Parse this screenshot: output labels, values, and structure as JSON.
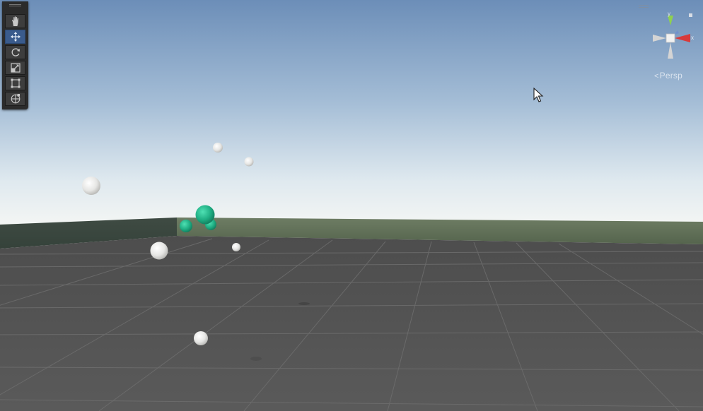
{
  "window": {
    "view": "Scene View"
  },
  "toolbar": {
    "tools": [
      {
        "id": "hand",
        "icon": "hand-icon",
        "active": false
      },
      {
        "id": "move",
        "icon": "move-icon",
        "active": true
      },
      {
        "id": "rotate",
        "icon": "rotate-icon",
        "active": false
      },
      {
        "id": "scale",
        "icon": "scale-icon",
        "active": false
      },
      {
        "id": "rect",
        "icon": "rect-transform-icon",
        "active": false
      },
      {
        "id": "transform",
        "icon": "transform-icon",
        "active": false
      }
    ]
  },
  "gizmo": {
    "y_label": "y",
    "x_label": "x",
    "projection_label": "Persp",
    "colors": {
      "x": "#d83a3a",
      "y": "#8fd14f",
      "z": "#5a8be0",
      "neutral": "#d9d9d9"
    }
  },
  "scene": {
    "colors": {
      "sky_top": "#6d8fb9",
      "sky_horizon": "#f2f4f3",
      "floor": "#595959",
      "grid": "#6d6d6d",
      "white_sphere": "#e8e8e6",
      "green_sphere": "#26b78b"
    },
    "objects": [
      {
        "kind": "white-sphere"
      },
      {
        "kind": "white-sphere"
      },
      {
        "kind": "white-sphere"
      },
      {
        "kind": "white-sphere"
      },
      {
        "kind": "white-sphere"
      },
      {
        "kind": "white-sphere"
      },
      {
        "kind": "green-sphere"
      },
      {
        "kind": "green-sphere"
      },
      {
        "kind": "green-sphere"
      }
    ]
  }
}
